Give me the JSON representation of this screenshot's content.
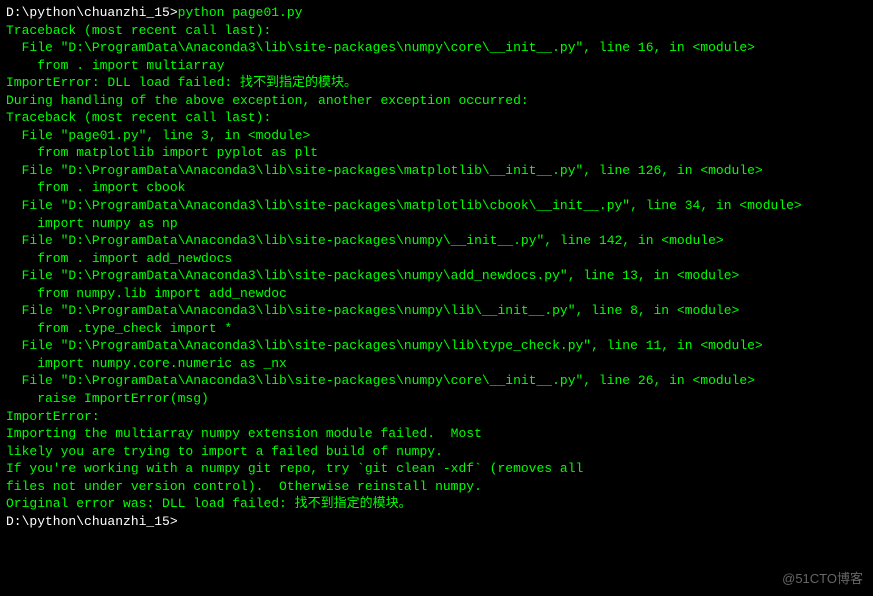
{
  "terminal": {
    "prompt1": "D:\\python\\chuanzhi_15>",
    "command1": "python page01.py",
    "lines": [
      "Traceback (most recent call last):",
      "  File \"D:\\ProgramData\\Anaconda3\\lib\\site-packages\\numpy\\core\\__init__.py\", line 16, in <module>",
      "    from . import multiarray",
      "ImportError: DLL load failed: 找不到指定的模块。",
      "",
      "During handling of the above exception, another exception occurred:",
      "",
      "Traceback (most recent call last):",
      "  File \"page01.py\", line 3, in <module>",
      "    from matplotlib import pyplot as plt",
      "  File \"D:\\ProgramData\\Anaconda3\\lib\\site-packages\\matplotlib\\__init__.py\", line 126, in <module>",
      "    from . import cbook",
      "  File \"D:\\ProgramData\\Anaconda3\\lib\\site-packages\\matplotlib\\cbook\\__init__.py\", line 34, in <module>",
      "    import numpy as np",
      "  File \"D:\\ProgramData\\Anaconda3\\lib\\site-packages\\numpy\\__init__.py\", line 142, in <module>",
      "    from . import add_newdocs",
      "  File \"D:\\ProgramData\\Anaconda3\\lib\\site-packages\\numpy\\add_newdocs.py\", line 13, in <module>",
      "    from numpy.lib import add_newdoc",
      "  File \"D:\\ProgramData\\Anaconda3\\lib\\site-packages\\numpy\\lib\\__init__.py\", line 8, in <module>",
      "    from .type_check import *",
      "  File \"D:\\ProgramData\\Anaconda3\\lib\\site-packages\\numpy\\lib\\type_check.py\", line 11, in <module>",
      "    import numpy.core.numeric as _nx",
      "  File \"D:\\ProgramData\\Anaconda3\\lib\\site-packages\\numpy\\core\\__init__.py\", line 26, in <module>",
      "    raise ImportError(msg)",
      "ImportError:",
      "Importing the multiarray numpy extension module failed.  Most",
      "likely you are trying to import a failed build of numpy.",
      "If you're working with a numpy git repo, try `git clean -xdf` (removes all",
      "files not under version control).  Otherwise reinstall numpy.",
      "",
      "Original error was: DLL load failed: 找不到指定的模块。",
      "",
      ""
    ],
    "prompt2": "D:\\python\\chuanzhi_15>"
  },
  "watermark": "@51CTO博客"
}
